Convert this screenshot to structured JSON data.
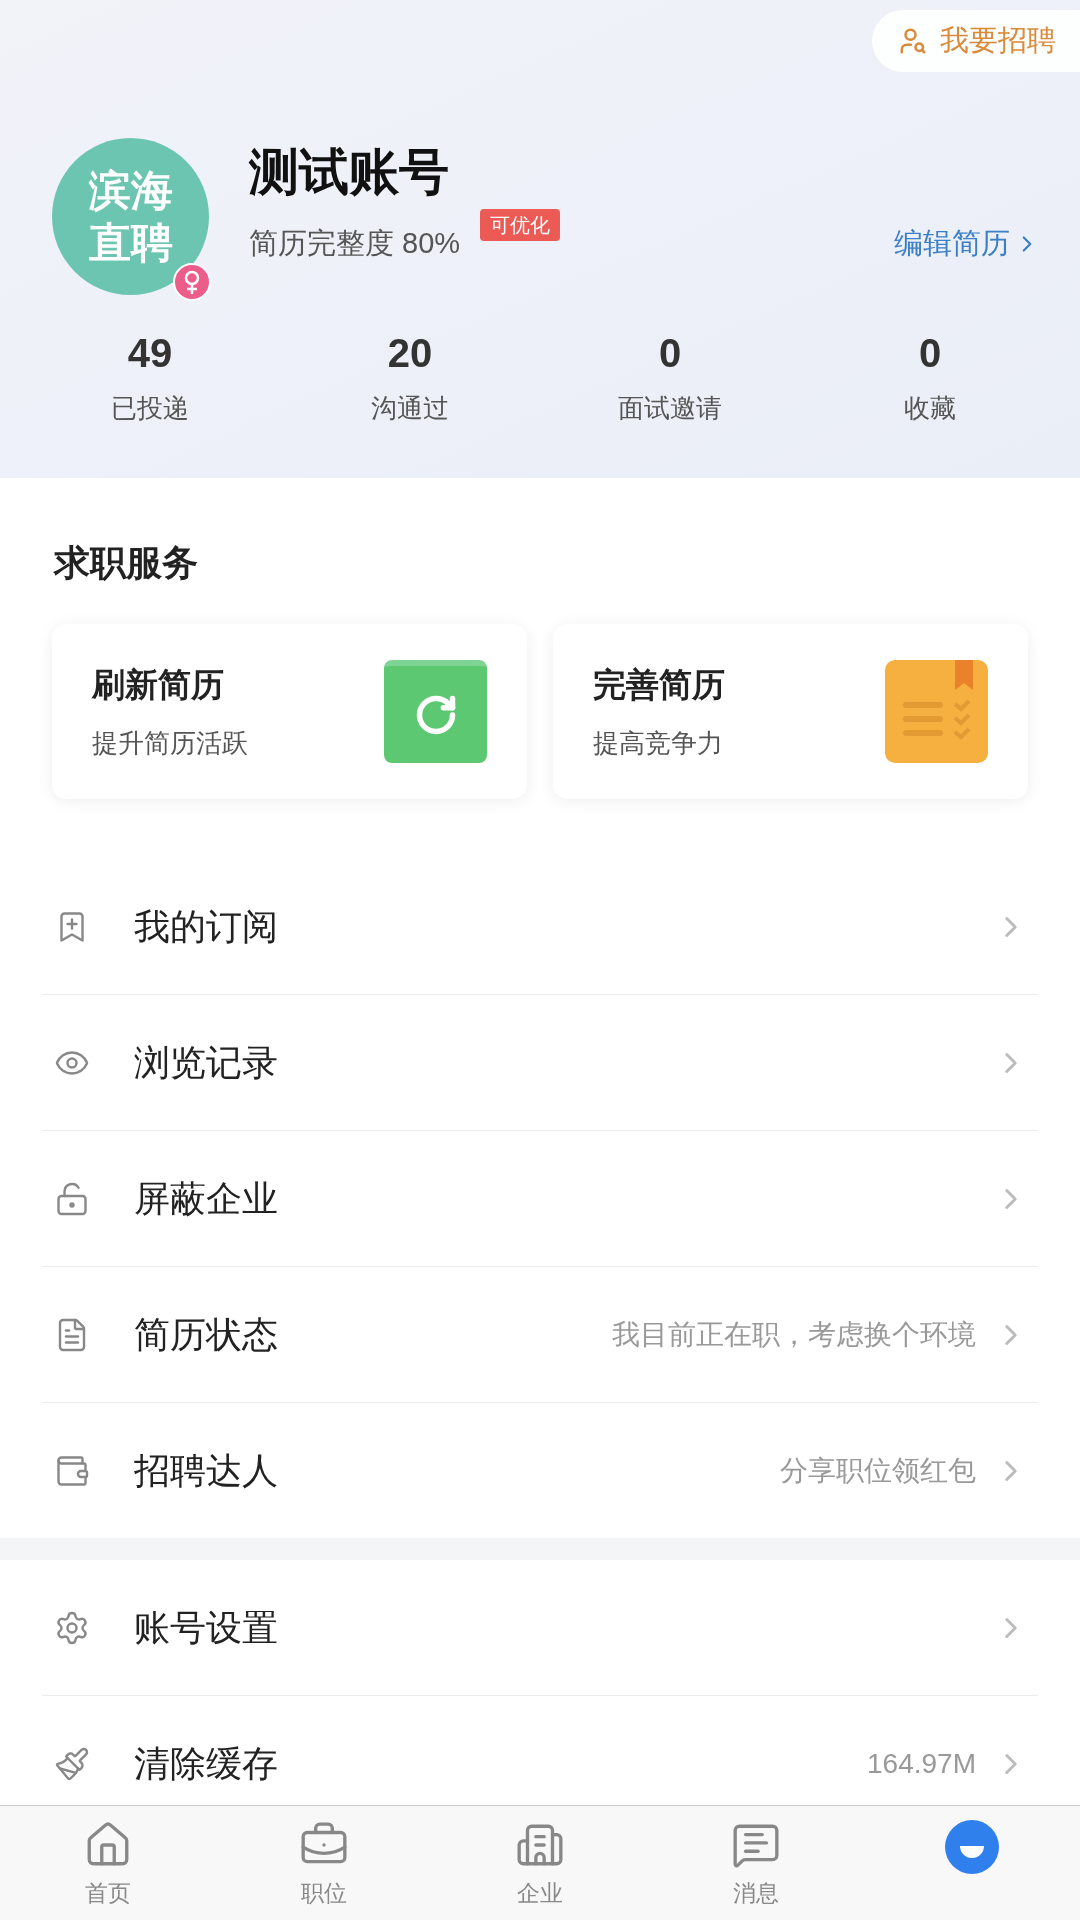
{
  "recruit_button": {
    "label": "我要招聘"
  },
  "profile": {
    "avatar_text": "滨海直聘",
    "name": "测试账号",
    "completeness": "简历完整度 80%",
    "badge": "可优化",
    "edit_link": "编辑简历"
  },
  "stats": [
    {
      "value": "49",
      "label": "已投递"
    },
    {
      "value": "20",
      "label": "沟通过"
    },
    {
      "value": "0",
      "label": "面试邀请"
    },
    {
      "value": "0",
      "label": "收藏"
    }
  ],
  "services": {
    "title": "求职服务",
    "cards": [
      {
        "kind": "refresh",
        "title": "刷新简历",
        "subtitle": "提升简历活跃"
      },
      {
        "kind": "document",
        "title": "完善简历",
        "subtitle": "提高竞争力"
      }
    ]
  },
  "menu_groups": [
    [
      {
        "kind": "subscribe",
        "label": "我的订阅"
      },
      {
        "kind": "history",
        "label": "浏览记录"
      },
      {
        "kind": "block",
        "label": "屏蔽企业"
      },
      {
        "kind": "status",
        "label": "简历状态",
        "value": "我目前正在职，考虑换个环境"
      },
      {
        "kind": "referral",
        "label": "招聘达人",
        "value": "分享职位领红包"
      }
    ],
    [
      {
        "kind": "settings",
        "label": "账号设置"
      },
      {
        "kind": "cache",
        "label": "清除缓存",
        "value": "164.97M"
      }
    ]
  ],
  "bottom_nav": [
    {
      "kind": "home",
      "label": "首页",
      "selected": false
    },
    {
      "kind": "jobs",
      "label": "职位",
      "selected": false
    },
    {
      "kind": "company",
      "label": "企业",
      "selected": false
    },
    {
      "kind": "messages",
      "label": "消息",
      "selected": false
    },
    {
      "kind": "me",
      "selected": true
    }
  ]
}
